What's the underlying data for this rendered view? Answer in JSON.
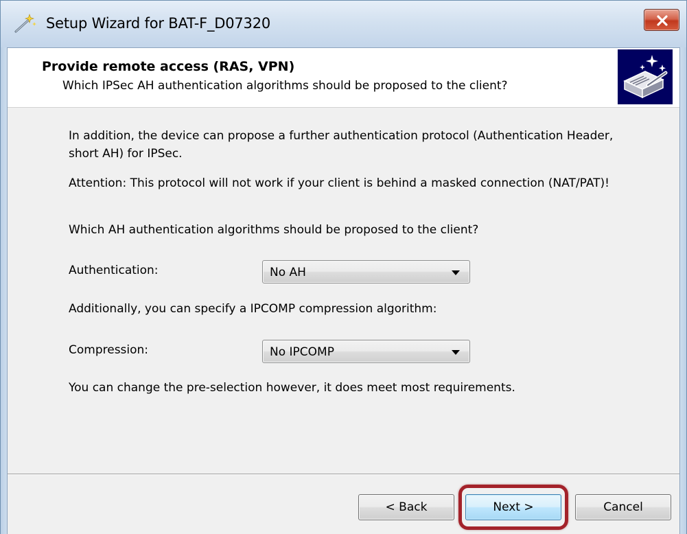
{
  "window": {
    "title": "Setup Wizard for BAT-F_D07320",
    "icon": "magic-wand-icon",
    "close_icon": "close-icon"
  },
  "header": {
    "title": "Provide remote access (RAS, VPN)",
    "subtitle": "Which IPSec AH authentication algorithms should be proposed to the client?",
    "logo_icon": "wizard-device-icon",
    "logo_color": "#000060"
  },
  "content": {
    "intro": "In addition, the device can propose a further authentication protocol (Authentication Header, short AH) for IPSec.",
    "attention": "Attention: This protocol will not work if your client is behind a masked connection (NAT/PAT)!",
    "question": "Which AH authentication algorithms should be proposed to the client?",
    "authentication": {
      "label": "Authentication:",
      "value": "No AH"
    },
    "compression_intro": "Additionally, you can specify a IPCOMP compression algorithm:",
    "compression": {
      "label": "Compression:",
      "value": "No IPCOMP"
    },
    "footer_note": "You can change the pre-selection however, it does meet most requirements."
  },
  "buttons": {
    "back": "< Back",
    "next": "Next >",
    "cancel": "Cancel"
  },
  "colors": {
    "highlight_ring": "#a3222a",
    "close_button": "#c1391e",
    "next_button_border": "#3c7fb1"
  }
}
